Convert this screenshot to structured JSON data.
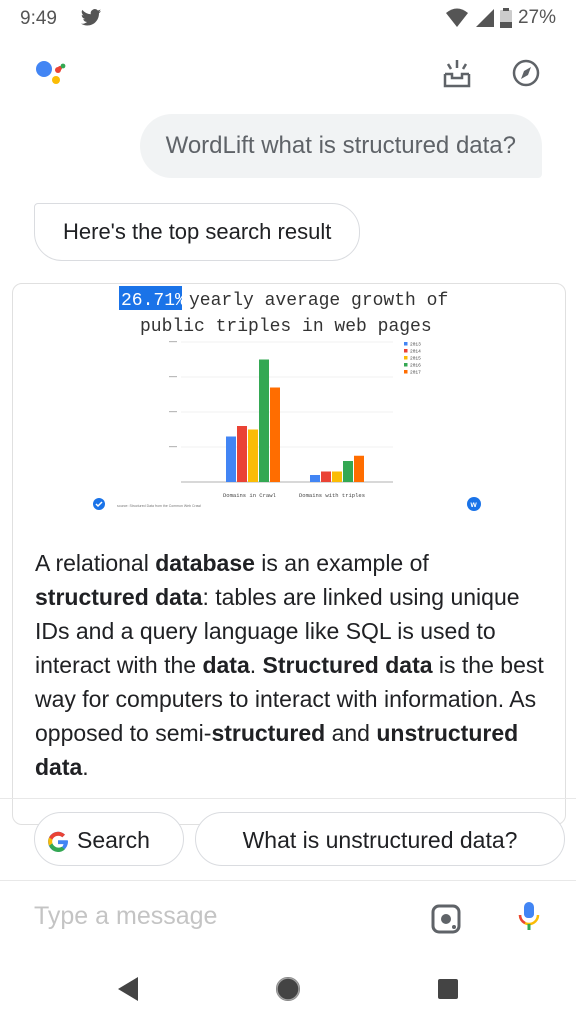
{
  "status": {
    "time": "9:49",
    "battery": "27%"
  },
  "chat": {
    "user_message": "WordLift what is structured data?",
    "assistant_message": "Here's the top search result"
  },
  "result": {
    "chart_headline_highlight": "26.71%",
    "chart_headline_rest": " yearly average growth of",
    "chart_headline_line2": "public triples in web pages",
    "chart_data": {
      "type": "bar",
      "categories": [
        "Domains in Crawl",
        "Domains with triples"
      ],
      "series": [
        {
          "name": "2013",
          "color": "#4285f4",
          "values": [
            13,
            2
          ]
        },
        {
          "name": "2014",
          "color": "#ea4335",
          "values": [
            16,
            3
          ]
        },
        {
          "name": "2015",
          "color": "#fbbc05",
          "values": [
            15,
            3
          ]
        },
        {
          "name": "2016",
          "color": "#34a853",
          "values": [
            35,
            6
          ]
        },
        {
          "name": "2017",
          "color": "#ff6d00",
          "values": [
            27,
            7.5
          ]
        }
      ],
      "source": "source: Structured Data from the Common Web Crawl"
    },
    "snippet": [
      {
        "t": "A relational ",
        "b": false
      },
      {
        "t": "database",
        "b": true
      },
      {
        "t": " is an example of ",
        "b": false
      },
      {
        "t": "structured data",
        "b": true
      },
      {
        "t": ": tables are linked using unique IDs and a query language like SQL is used to interact with the ",
        "b": false
      },
      {
        "t": "data",
        "b": true
      },
      {
        "t": ". ",
        "b": false
      },
      {
        "t": "Structured data",
        "b": true
      },
      {
        "t": " is the best way for computers to interact with information. As opposed to semi-",
        "b": false
      },
      {
        "t": "structured",
        "b": true
      },
      {
        "t": " and ",
        "b": false
      },
      {
        "t": "unstructured data",
        "b": true
      },
      {
        "t": ".",
        "b": false
      }
    ]
  },
  "suggestions": {
    "search": "Search",
    "question": "What is unstructured data?"
  },
  "input": {
    "placeholder": "Type a message"
  }
}
